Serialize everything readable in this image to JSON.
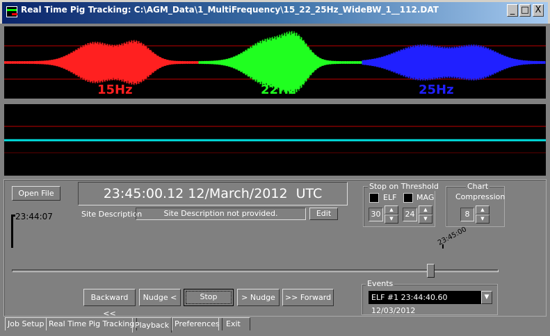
{
  "window": {
    "title": "Real Time Pig Tracking: C:\\AGM_Data\\1_MultiFrequency\\15_22_25Hz_WideBW_1__112.DAT",
    "minimize": "_",
    "maximize": "□",
    "close": "X"
  },
  "plot_top": {
    "labels": [
      {
        "text": "15Hz",
        "color": "#ff2020"
      },
      {
        "text": "22Hz",
        "color": "#20ff20"
      },
      {
        "text": "25Hz",
        "color": "#2020ff"
      }
    ]
  },
  "plot_bottom": {
    "trace_color": "#00e0e0"
  },
  "controls": {
    "open_file": "Open File",
    "datetime": "23:45:00.12 12/March/2012  UTC",
    "site_description_label": "Site Description",
    "site_description_value": "Site Description not provided.",
    "edit": "Edit",
    "time_left": "23:44:07",
    "time_marker": "23:45:00",
    "slider_position_percent": 86
  },
  "threshold": {
    "title": "Stop on Threshold",
    "elf_label": "ELF",
    "mag_label": "MAG",
    "elf_value": "30",
    "mag_value": "24"
  },
  "chart": {
    "title": "Chart",
    "compression_label": "Compression",
    "compression_value": "8"
  },
  "playback": {
    "backward": "Backward <<",
    "nudge_back": "Nudge <",
    "stop": "Stop",
    "nudge_fwd": "> Nudge",
    "forward": ">> Forward"
  },
  "events": {
    "title": "Events",
    "selected": "ELF #1 23:44:40.60 12/03/2012"
  },
  "tabs": [
    {
      "label": "Job Setup"
    },
    {
      "label": "Real Time Pig Tracking"
    },
    {
      "label": "Playback",
      "active": true
    },
    {
      "label": "Preferences"
    },
    {
      "label": "Exit"
    }
  ]
}
